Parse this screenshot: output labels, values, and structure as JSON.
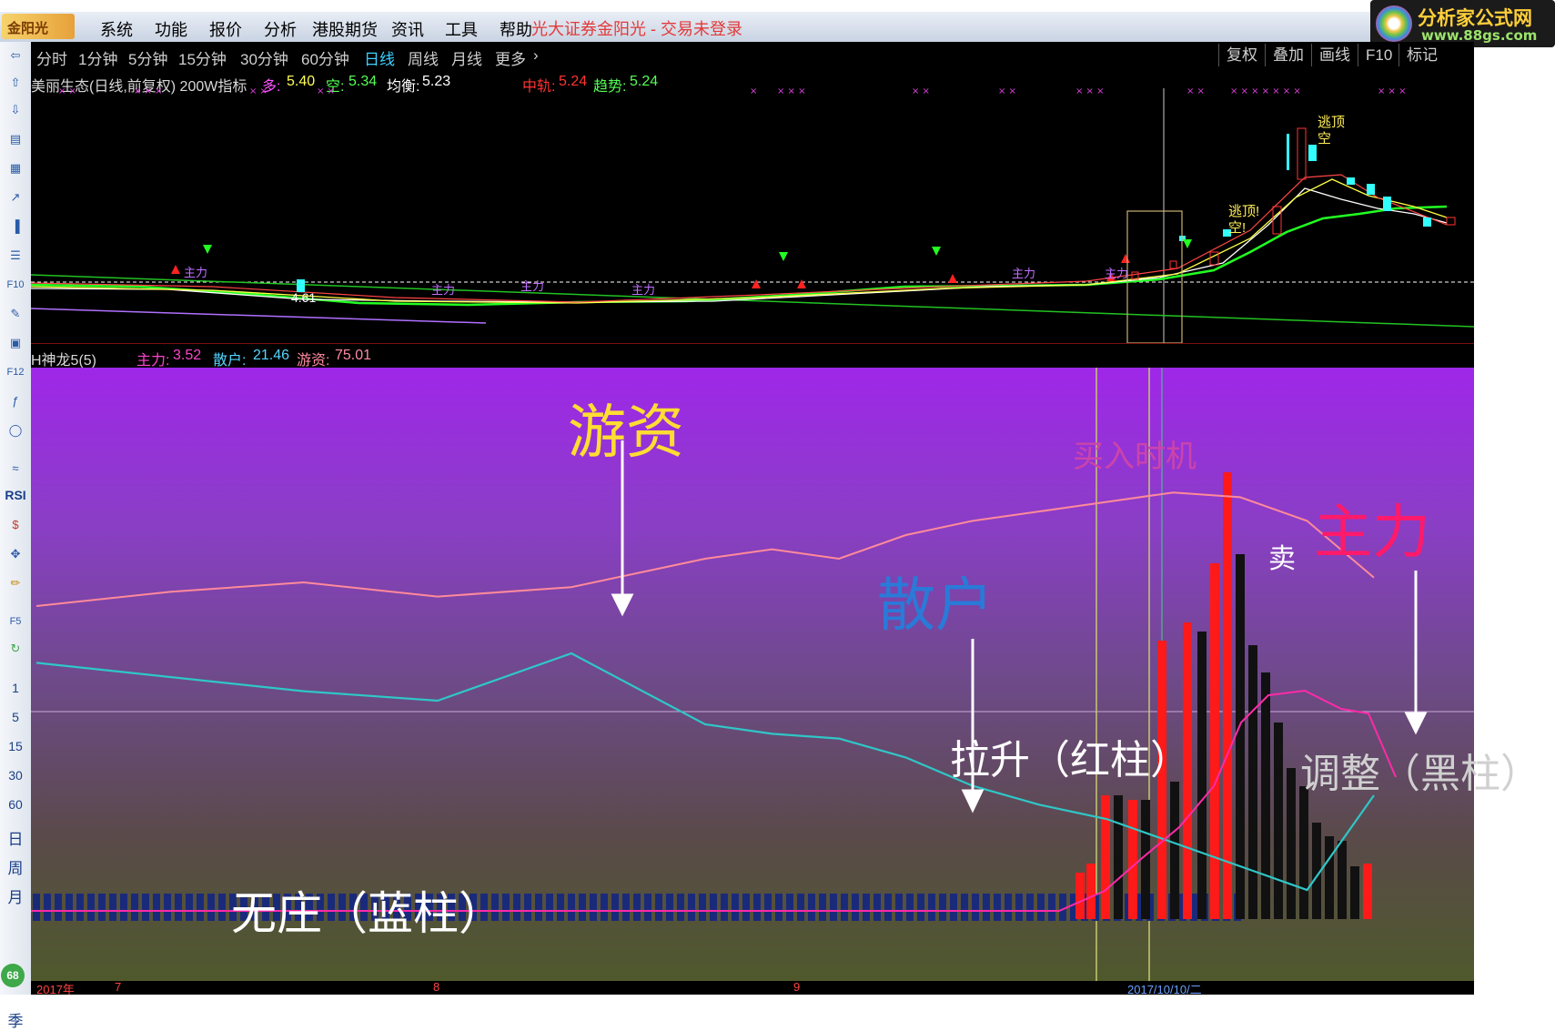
{
  "menu": {
    "items": [
      "系统",
      "功能",
      "报价",
      "分析",
      "港股期货",
      "资讯",
      "工具",
      "帮助"
    ],
    "status_title": "光大证券金阳光 - 交易未登录"
  },
  "brand": {
    "name": "分析家公式网",
    "url": "www.88gs.com"
  },
  "period_tabs": [
    "分时",
    "1分钟",
    "5分钟",
    "15分钟",
    "30分钟",
    "60分钟",
    "日线",
    "周线",
    "月线",
    "更多"
  ],
  "active_tab": "日线",
  "right_tabs": [
    "复权",
    "叠加",
    "画线",
    "F10",
    "标记"
  ],
  "left_toolbar": {
    "labels": [
      "RSI",
      "1",
      "5",
      "15",
      "30",
      "60",
      "日",
      "周",
      "月",
      "季"
    ],
    "badge": "68"
  },
  "main_chart": {
    "title": "美丽生态(日线,前复权) 200W指标",
    "duo_label": "多:",
    "duo_value": "5.40",
    "kong_label": "空:",
    "kong_value": "5.34",
    "junheng_label": "均衡:",
    "junheng_value": "5.23",
    "zhonggui_label": "中轨:",
    "zhonggui_value": "5.24",
    "qushi_label": "趋势:",
    "qushi_value": "5.24",
    "low_price": "4.61",
    "signal_escape": "逃顶",
    "signal_empty": "空",
    "signal_escape2": "逃顶!",
    "signal_empty2": "空!",
    "bottom_label": "主力"
  },
  "indicator": {
    "name": "H神龙5(5)",
    "zhuli_label": "主力:",
    "zhuli_value": "3.52",
    "sanhu_label": "散户:",
    "sanhu_value": "21.46",
    "youzi_label": "游资:",
    "youzi_value": "75.01",
    "colors": {
      "zhuli": "#ff2aa0",
      "sanhu": "#2fc7c7",
      "youzi": "#ff8aa0",
      "red_bar": "#ff1a1a",
      "black_bar": "#111111",
      "blue_bar": "#1a2a7a"
    }
  },
  "annotations": {
    "youzi": "游资",
    "sanhu": "散户",
    "zhuli": "主力",
    "buy_timing": "买入时机",
    "sell": "卖",
    "lashen": "拉升（红柱）",
    "tiaozheng": "调整（黑柱）",
    "wuzhuang": "无庄（蓝柱）"
  },
  "date_axis": {
    "year": "2017年",
    "m1": "7",
    "m2": "8",
    "m3": "9",
    "date": "2017/10/10/二"
  },
  "chart_data": {
    "type": "line",
    "title": "",
    "series": [
      {
        "name": "游资",
        "x": [
          0,
          10,
          20,
          30,
          40,
          50,
          55,
          60,
          65,
          70,
          75,
          80,
          85,
          90,
          95,
          100
        ],
        "values": [
          70,
          73,
          75,
          72,
          74,
          80,
          82,
          80,
          85,
          88,
          90,
          92,
          94,
          93,
          88,
          76
        ]
      },
      {
        "name": "散户",
        "x": [
          0,
          10,
          20,
          30,
          40,
          50,
          55,
          60,
          65,
          70,
          75,
          80,
          85,
          90,
          95,
          100
        ],
        "values": [
          58,
          55,
          52,
          50,
          60,
          45,
          43,
          42,
          38,
          32,
          28,
          25,
          20,
          15,
          10,
          30
        ]
      }
    ]
  }
}
